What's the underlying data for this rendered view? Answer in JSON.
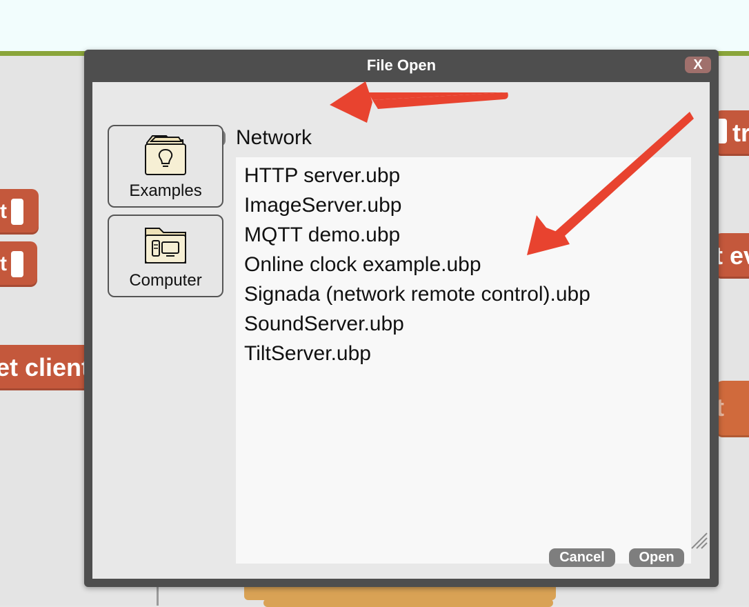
{
  "dialog": {
    "title": "File Open",
    "close_label": "X",
    "back_label": "<",
    "folder_name": "Network",
    "sources": [
      {
        "label": "Examples",
        "icon": "examples-lightbulb-folder-icon"
      },
      {
        "label": "Computer",
        "icon": "computer-folder-icon"
      }
    ],
    "files": [
      "HTTP server.ubp",
      "ImageServer.ubp",
      "MQTT demo.ubp",
      "Online clock example.ubp",
      "Signada (network remote control).ubp",
      "SoundServer.ubp",
      "TiltServer.ubp"
    ],
    "cancel_label": "Cancel",
    "open_label": "Open"
  },
  "background_blocks": {
    "block_1": "t",
    "block_2": "t",
    "block_3": "et client",
    "block_4": "tr",
    "block_5": "t ev",
    "block_6": "t"
  },
  "colors": {
    "block_red": "#c4583c",
    "block_orange": "#d9a255",
    "dialog_frame": "#4e4e4e",
    "annotation_arrow": "#e8432f",
    "accent_green": "#8aa53a"
  }
}
